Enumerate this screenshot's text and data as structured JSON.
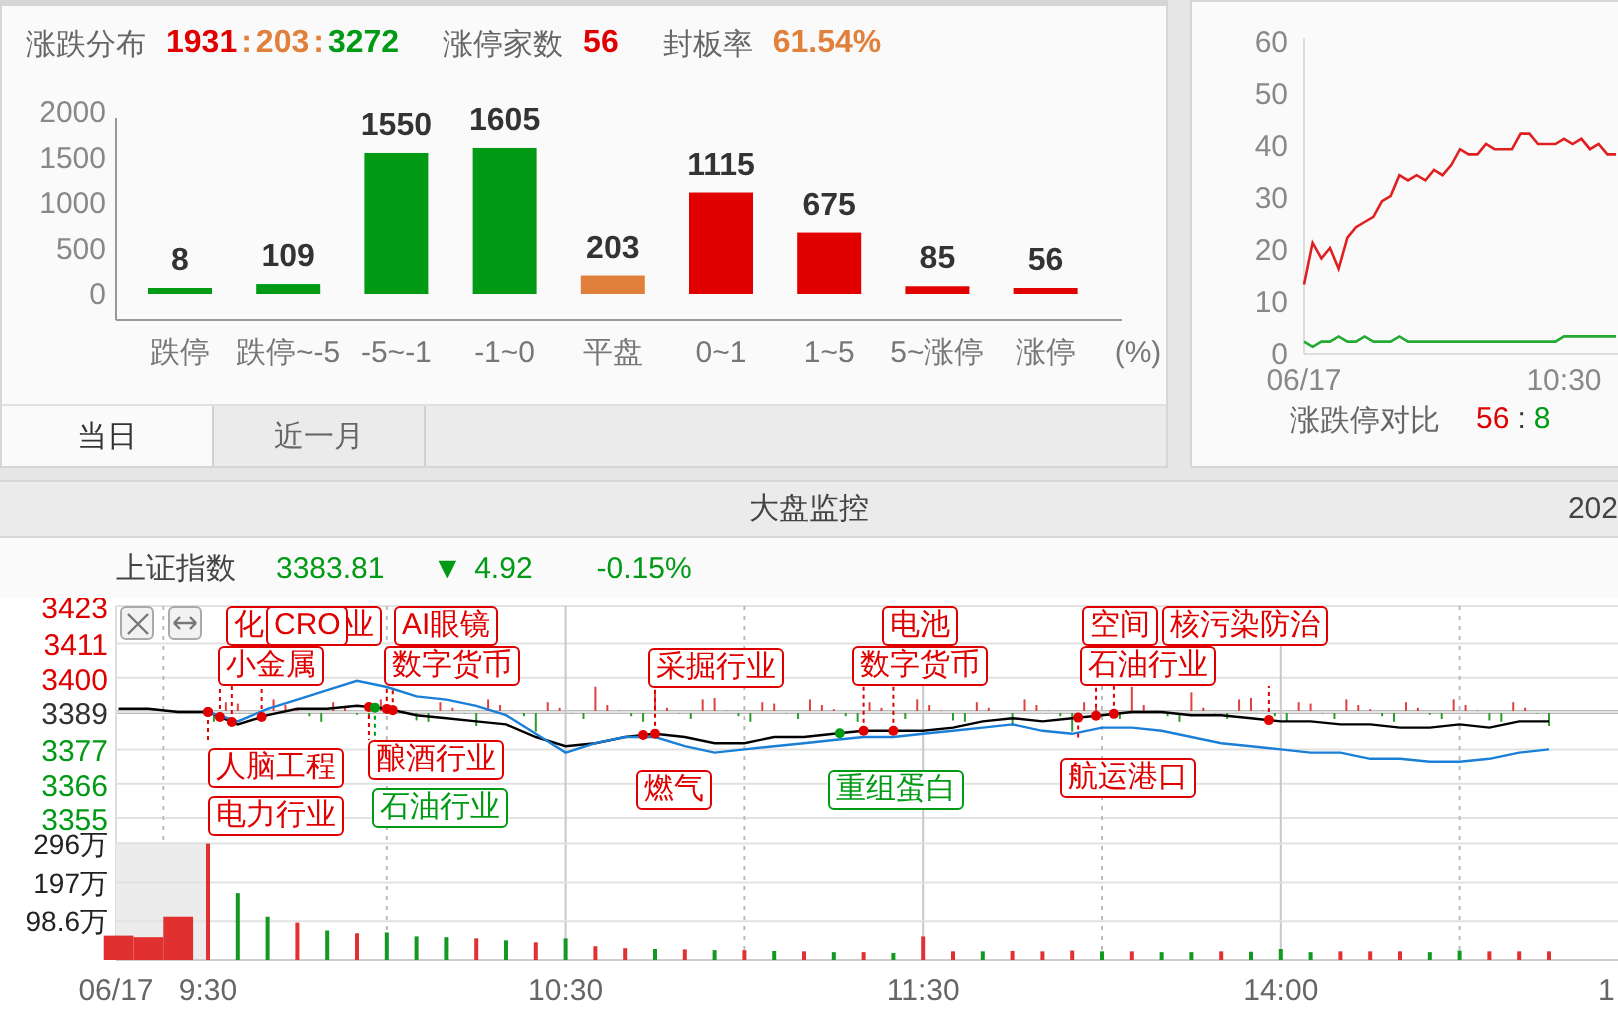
{
  "distribution": {
    "label": "涨跌分布",
    "ratio": [
      {
        "text": "1931",
        "color": "#e00000"
      },
      {
        "text": ":",
        "color": "#e0803a"
      },
      {
        "text": "203",
        "color": "#e0803a"
      },
      {
        "text": ":",
        "color": "#e0803a"
      },
      {
        "text": "3272",
        "color": "#009a15"
      }
    ],
    "metrics": [
      {
        "label": "涨停家数",
        "value": "56",
        "color": "#e00000"
      },
      {
        "label": "封板率",
        "value": "61.54%",
        "color": "#e0803a"
      }
    ],
    "chart_data": {
      "type": "bar",
      "categories": [
        "跌停",
        "跌停~-5",
        "-5~-1",
        "-1~0",
        "平盘",
        "0~1",
        "1~5",
        "5~涨停",
        "涨停"
      ],
      "series": [
        {
          "color": "#009a15",
          "values": [
            8,
            109,
            1550,
            1605,
            null,
            null,
            null,
            null,
            null
          ]
        },
        {
          "color": "#e0803a",
          "values": [
            null,
            null,
            null,
            null,
            203,
            null,
            null,
            null,
            null
          ]
        },
        {
          "color": "#e00000",
          "values": [
            null,
            null,
            null,
            null,
            null,
            1115,
            675,
            85,
            56
          ]
        }
      ],
      "xlabel": "(%)",
      "ylim": [
        0,
        2000
      ],
      "yticks": [
        0,
        500,
        1000,
        1500,
        2000
      ],
      "data_labels": true
    },
    "tabs": [
      {
        "label": "当日",
        "selected": true
      },
      {
        "label": "近一月",
        "selected": false
      }
    ]
  },
  "limit_compare": {
    "label": "涨跌停对比",
    "parts": [
      {
        "text": "56",
        "color": "#e00000"
      },
      {
        "text": ":",
        "color": "#333333"
      },
      {
        "text": "8",
        "color": "#009a15"
      }
    ],
    "chart_data": {
      "type": "line",
      "categories": [
        "06/17",
        null,
        null,
        null,
        null,
        null,
        null,
        null,
        null,
        null,
        null,
        null,
        null,
        null,
        null,
        null,
        null,
        null,
        null,
        null,
        null,
        null,
        null,
        null,
        null,
        null,
        null,
        null,
        null,
        null,
        "10:30",
        null,
        null,
        null,
        null,
        null,
        null
      ],
      "series": [
        {
          "color": "#e02020",
          "values": [
            13,
            21,
            18,
            20,
            16,
            22,
            24,
            25,
            26,
            29,
            30,
            34,
            33,
            34,
            33,
            35,
            34,
            36,
            39,
            38,
            38,
            40,
            39,
            39,
            39,
            42,
            42,
            40,
            40,
            40,
            41,
            40,
            41,
            39,
            40,
            38,
            38
          ]
        },
        {
          "color": "#22aa33",
          "values": [
            2,
            1,
            2,
            2,
            3,
            2,
            2,
            3,
            2,
            2,
            2,
            3,
            2,
            2,
            2,
            2,
            2,
            2,
            2,
            2,
            2,
            2,
            2,
            2,
            2,
            2,
            2,
            2,
            2,
            2,
            3,
            3,
            3,
            3,
            3,
            3,
            3
          ]
        }
      ],
      "ylim": [
        0,
        60
      ],
      "yticks": [
        0,
        10,
        20,
        30,
        40,
        50,
        60
      ]
    }
  },
  "monitor": {
    "title": "大盘监控",
    "right_text": "202",
    "index": {
      "name": "上证指数",
      "value": "3383.81",
      "arrow": "▼",
      "change": "4.92",
      "percent": "-0.15%",
      "color": "#009a15"
    },
    "chart_data": {
      "type": "line",
      "grid": true,
      "series": [
        {
          "color": "#000000",
          "values": [
            3390,
            3390,
            3389,
            3389,
            3385,
            3388,
            3390,
            3390,
            3391,
            3390,
            3388,
            3387,
            3386,
            3385,
            3381,
            3378,
            3379,
            3381,
            3382,
            3381,
            3379,
            3379,
            3381,
            3381,
            3382,
            3383,
            3383,
            3383,
            3384,
            3386,
            3387,
            3386,
            3387,
            3388,
            3389,
            3389,
            3388,
            3388,
            3387,
            3386,
            3386,
            3385,
            3385,
            3384,
            3384,
            3385,
            3384,
            3386,
            3386
          ]
        },
        {
          "color": "#1a7fd6",
          "values": [
            null,
            null,
            null,
            3389,
            3386,
            3390,
            3393,
            3396,
            3399,
            3397,
            3394,
            3393,
            3391,
            3388,
            3382,
            3376,
            3379,
            3381,
            3381,
            3378,
            3376,
            3377,
            3378,
            3379,
            3380,
            3381,
            3381,
            3382,
            3383,
            3384,
            3385,
            3383,
            3382,
            3384,
            3384,
            3383,
            3381,
            3379,
            3378,
            3377,
            3376,
            3376,
            3374,
            3374,
            3373,
            3373,
            3374,
            3376,
            3377
          ]
        }
      ],
      "ylim": [
        3355,
        3423
      ],
      "yticks": [
        3355,
        3366,
        3377,
        3389,
        3400,
        3411,
        3423
      ]
    },
    "event_tags": [
      {
        "text": "化 业",
        "color": "#e00000"
      },
      {
        "text": "CRO",
        "color": "#e00000"
      },
      {
        "text": "小金属",
        "color": "#e00000"
      },
      {
        "text": "AI眼镜",
        "color": "#e00000"
      },
      {
        "text": "数字货币",
        "color": "#e00000"
      },
      {
        "text": "采掘行业",
        "color": "#e00000"
      },
      {
        "text": "电池",
        "color": "#e00000"
      },
      {
        "text": "数字货币",
        "color": "#e00000"
      },
      {
        "text": "空间",
        "color": "#e00000"
      },
      {
        "text": "核污染防治",
        "color": "#e00000"
      },
      {
        "text": "石油行业",
        "color": "#e00000"
      },
      {
        "text": "人脑工程",
        "color": "#e00000"
      },
      {
        "text": "电力行业",
        "color": "#e00000"
      },
      {
        "text": "酿酒行业",
        "color": "#e00000"
      },
      {
        "text": "石油行业",
        "color": "#009a15"
      },
      {
        "text": "燃气",
        "color": "#e00000"
      },
      {
        "text": "重组蛋白",
        "color": "#009a15"
      },
      {
        "text": "航运港口",
        "color": "#e00000"
      }
    ],
    "volume": {
      "edge_label": "1",
      "chart_data": {
        "type": "bar",
        "categories": [
          "06/17",
          null,
          null,
          "9:30",
          null,
          null,
          null,
          null,
          null,
          null,
          null,
          null,
          null,
          null,
          null,
          "10:30",
          null,
          null,
          null,
          null,
          null,
          null,
          null,
          null,
          null,
          null,
          null,
          "11:30",
          null,
          null,
          null,
          null,
          null,
          null,
          null,
          null,
          null,
          null,
          null,
          "14:00",
          null,
          null,
          null,
          null,
          null,
          null,
          null,
          null,
          null
        ],
        "series": [
          {
            "color": "#e03030",
            "values": [
              62,
              58,
              110,
              296,
              null,
              null,
              95,
              null,
              68,
              null,
              null,
              null,
              55,
              null,
              45,
              null,
              35,
              30,
              null,
              27,
              null,
              25,
              null,
              22,
              null,
              20,
              null,
              60,
              22,
              null,
              23,
              22,
              24,
              null,
              22,
              null,
              null,
              22,
              null,
              null,
              null,
              22,
              22,
              22,
              null,
              null,
              22,
              22,
              22
            ]
          },
          {
            "color": "#119922",
            "values": [
              null,
              null,
              null,
              null,
              170,
              110,
              null,
              75,
              null,
              70,
              60,
              58,
              null,
              50,
              null,
              55,
              null,
              null,
              28,
              null,
              25,
              null,
              23,
              null,
              20,
              null,
              18,
              null,
              null,
              22,
              null,
              null,
              null,
              22,
              null,
              20,
              20,
              null,
              21,
              28,
              20,
              null,
              null,
              null,
              20,
              24,
              null,
              null,
              null
            ]
          }
        ],
        "ylim": [
          0,
          300
        ],
        "yticks": [
          {
            "value": 98.6,
            "label": "98.6万"
          },
          {
            "value": 197,
            "label": "197万"
          },
          {
            "value": 296,
            "label": "296万"
          }
        ]
      }
    }
  }
}
